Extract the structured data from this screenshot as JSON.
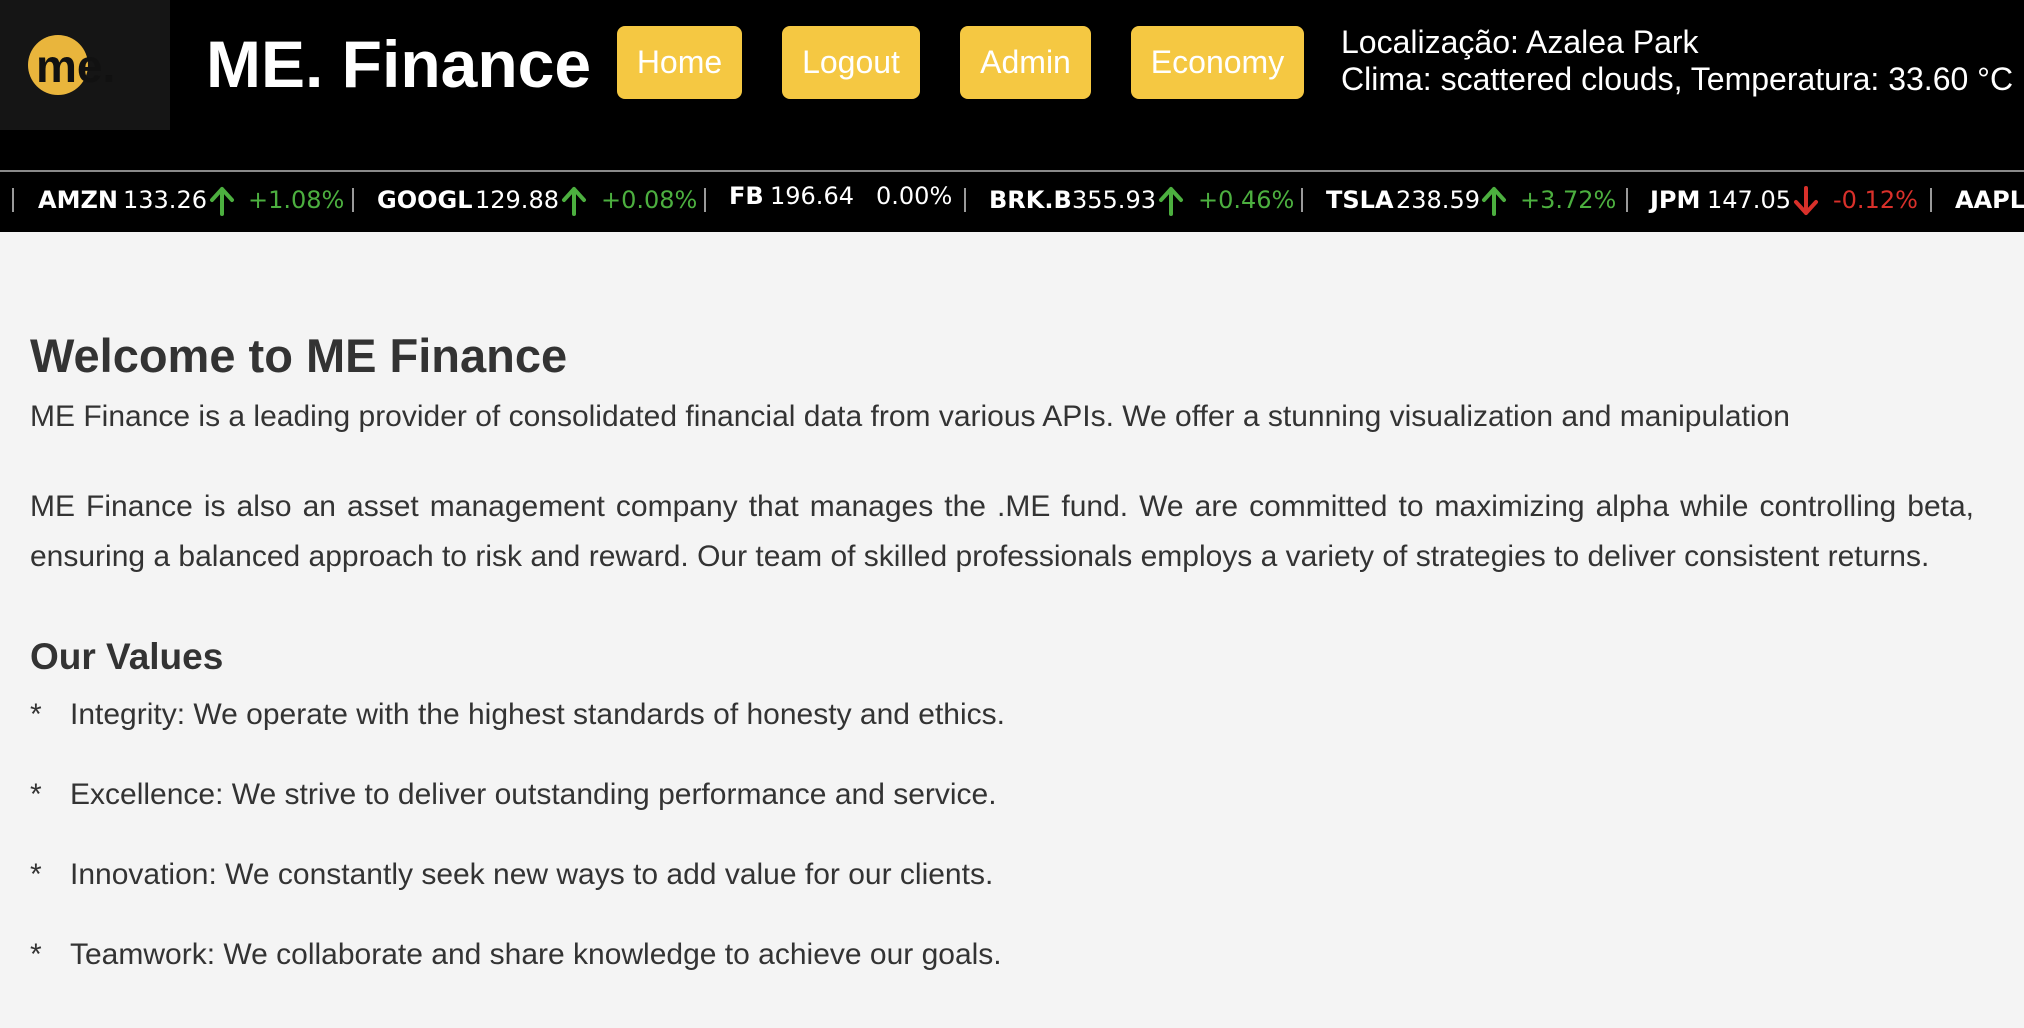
{
  "header": {
    "logo_text": "me.",
    "site_title": "ME. Finance",
    "nav": {
      "home": "Home",
      "logout": "Logout",
      "admin": "Admin",
      "economy": "Economy"
    },
    "weather": {
      "location_line": "Localização: Azalea Park",
      "climate_line": "Clima: scattered clouds, Temperatura: 33.60 °C"
    }
  },
  "ticker": [
    {
      "symbol": "AMZN",
      "price": "133.26",
      "change": "+1.08%",
      "direction": "up"
    },
    {
      "symbol": "GOOGL",
      "price": "129.88",
      "change": "+0.08%",
      "direction": "up"
    },
    {
      "symbol": "FB",
      "price": "196.64",
      "change": "0.00%",
      "direction": "flat"
    },
    {
      "symbol": "BRK.B",
      "price": "355.93",
      "change": "+0.46%",
      "direction": "up"
    },
    {
      "symbol": "TSLA",
      "price": "238.59",
      "change": "+3.72%",
      "direction": "up"
    },
    {
      "symbol": "JPM",
      "price": "147.05",
      "change": "-0.12%",
      "direction": "down"
    },
    {
      "symbol": "AAPL",
      "price": "",
      "change": "",
      "direction": ""
    }
  ],
  "colors": {
    "accent": "#f5c842",
    "up": "#4caf3f",
    "down": "#d9302a",
    "header_bg": "#000000",
    "page_bg": "#f4f4f4"
  },
  "main": {
    "title": "Welcome to ME Finance",
    "intro": "ME Finance is a leading provider of consolidated financial data from various APIs. We offer a stunning visualization and manipulation",
    "about": "ME Finance is also an asset management company that manages the .ME fund. We are committed to maximizing alpha while controlling beta, ensuring a balanced approach to risk and reward. Our team of skilled professionals employs a variety of strategies to deliver consistent returns.",
    "values_title": "Our Values",
    "bullet": "*",
    "values": [
      "Integrity: We operate with the highest standards of honesty and ethics.",
      "Excellence: We strive to deliver outstanding performance and service.",
      "Innovation: We constantly seek new ways to add value for our clients.",
      "Teamwork: We collaborate and share knowledge to achieve our goals."
    ]
  }
}
